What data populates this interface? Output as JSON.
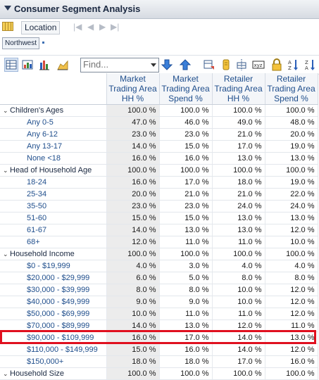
{
  "title": "Consumer Segment Analysis",
  "location_button": "Location",
  "nav": [
    "|◀",
    "◀",
    "▶",
    "▶|"
  ],
  "filter_value": "Northwest",
  "toolbar": {
    "find_placeholder": "Find...",
    "icons": [
      "table-view-icon",
      "chart-icon",
      "bar-chart-icon",
      "area-chart-icon",
      "arrow-down-icon",
      "arrow-up-icon",
      "pivot-icon",
      "export-icon",
      "layout-icon",
      "xyz-icon",
      "lock-icon",
      "sort-asc-icon",
      "sort-desc-icon"
    ]
  },
  "columns": [
    "Market Trading Area HH %",
    "Market Trading Area Spend %",
    "Retailer Trading Area HH %",
    "Retailer Trading Area Spend %"
  ],
  "column_lines": [
    [
      "Market",
      "Trading Area",
      "HH %"
    ],
    [
      "Market",
      "Trading Area",
      "Spend %"
    ],
    [
      "Retailer",
      "Trading Area",
      "HH %"
    ],
    [
      "Retailer",
      "Trading Area",
      "Spend %"
    ]
  ],
  "rows": [
    {
      "label": "Children's Ages",
      "group": true,
      "values": [
        "100.0 %",
        "100.0 %",
        "100.0 %",
        "100.0 %"
      ]
    },
    {
      "label": "Any 0-5",
      "values": [
        "47.0 %",
        "46.0 %",
        "49.0 %",
        "48.0 %"
      ]
    },
    {
      "label": "Any 6-12",
      "values": [
        "23.0 %",
        "23.0 %",
        "21.0 %",
        "20.0 %"
      ]
    },
    {
      "label": "Any 13-17",
      "values": [
        "14.0 %",
        "15.0 %",
        "17.0 %",
        "19.0 %"
      ]
    },
    {
      "label": "None <18",
      "values": [
        "16.0 %",
        "16.0 %",
        "13.0 %",
        "13.0 %"
      ]
    },
    {
      "label": "Head of Household Age",
      "group": true,
      "values": [
        "100.0 %",
        "100.0 %",
        "100.0 %",
        "100.0 %"
      ]
    },
    {
      "label": "18-24",
      "values": [
        "16.0 %",
        "17.0 %",
        "18.0 %",
        "19.0 %"
      ]
    },
    {
      "label": "25-34",
      "values": [
        "20.0 %",
        "21.0 %",
        "21.0 %",
        "22.0 %"
      ]
    },
    {
      "label": "35-50",
      "values": [
        "23.0 %",
        "23.0 %",
        "24.0 %",
        "24.0 %"
      ]
    },
    {
      "label": "51-60",
      "values": [
        "15.0 %",
        "15.0 %",
        "13.0 %",
        "13.0 %"
      ]
    },
    {
      "label": "61-67",
      "values": [
        "14.0 %",
        "13.0 %",
        "13.0 %",
        "12.0 %"
      ]
    },
    {
      "label": "68+",
      "values": [
        "12.0 %",
        "11.0 %",
        "11.0 %",
        "10.0 %"
      ]
    },
    {
      "label": "Household Income",
      "group": true,
      "values": [
        "100.0 %",
        "100.0 %",
        "100.0 %",
        "100.0 %"
      ]
    },
    {
      "label": "$0 - $19,999",
      "values": [
        "4.0 %",
        "3.0 %",
        "4.0 %",
        "4.0 %"
      ]
    },
    {
      "label": "$20,000 - $29,999",
      "values": [
        "6.0 %",
        "5.0 %",
        "8.0 %",
        "8.0 %"
      ]
    },
    {
      "label": "$30,000 - $39,999",
      "values": [
        "8.0 %",
        "8.0 %",
        "10.0 %",
        "12.0 %"
      ]
    },
    {
      "label": "$40,000 - $49,999",
      "values": [
        "9.0 %",
        "9.0 %",
        "10.0 %",
        "12.0 %"
      ]
    },
    {
      "label": "$50,000 - $69,999",
      "values": [
        "10.0 %",
        "11.0 %",
        "11.0 %",
        "12.0 %"
      ]
    },
    {
      "label": "$70,000 - $89,999",
      "values": [
        "14.0 %",
        "13.0 %",
        "12.0 %",
        "11.0 %"
      ]
    },
    {
      "label": "$90,000 - $109,999",
      "values": [
        "16.0 %",
        "17.0 %",
        "14.0 %",
        "13.0 %"
      ],
      "highlight": true
    },
    {
      "label": "$110,000 - $149,999",
      "values": [
        "15.0 %",
        "16.0 %",
        "14.0 %",
        "12.0 %"
      ]
    },
    {
      "label": "$150,000+",
      "values": [
        "18.0 %",
        "18.0 %",
        "17.0 %",
        "16.0 %"
      ]
    },
    {
      "label": "Household Size",
      "group": true,
      "values": [
        "100.0 %",
        "100.0 %",
        "100.0 %",
        "100.0 %"
      ]
    }
  ],
  "colors": {
    "highlight_border": "#e0101f",
    "header_text": "#1f4e8c",
    "first_col_bg": "#ececec"
  }
}
